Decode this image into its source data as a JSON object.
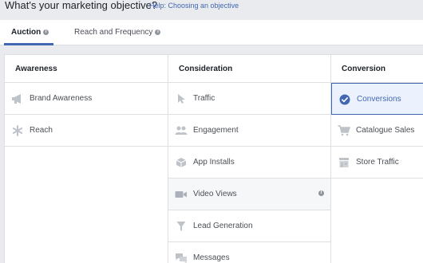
{
  "header": {
    "title": "What's your marketing objective?",
    "help_link": "Help: Choosing an objective"
  },
  "tabs": [
    {
      "label": "Auction",
      "active": true
    },
    {
      "label": "Reach and Frequency",
      "active": false
    }
  ],
  "columns": {
    "awareness": {
      "title": "Awareness",
      "items": [
        {
          "label": "Brand Awareness",
          "icon": "megaphone-icon"
        },
        {
          "label": "Reach",
          "icon": "asterisk-icon"
        }
      ]
    },
    "consideration": {
      "title": "Consideration",
      "items": [
        {
          "label": "Traffic",
          "icon": "cursor-icon"
        },
        {
          "label": "Engagement",
          "icon": "people-icon"
        },
        {
          "label": "App Installs",
          "icon": "box-icon"
        },
        {
          "label": "Video Views",
          "icon": "video-camera-icon"
        },
        {
          "label": "Lead Generation",
          "icon": "funnel-icon"
        },
        {
          "label": "Messages",
          "icon": "chat-bubbles-icon"
        }
      ]
    },
    "conversion": {
      "title": "Conversion",
      "items": [
        {
          "label": "Conversions",
          "icon": "check-circle-icon",
          "selected": true
        },
        {
          "label": "Catalogue Sales",
          "icon": "cart-icon"
        },
        {
          "label": "Store Traffic",
          "icon": "store-icon"
        }
      ]
    }
  },
  "colors": {
    "accent": "#4267b2",
    "icon_gray": "#bec3c9",
    "border": "#dddfe2"
  }
}
